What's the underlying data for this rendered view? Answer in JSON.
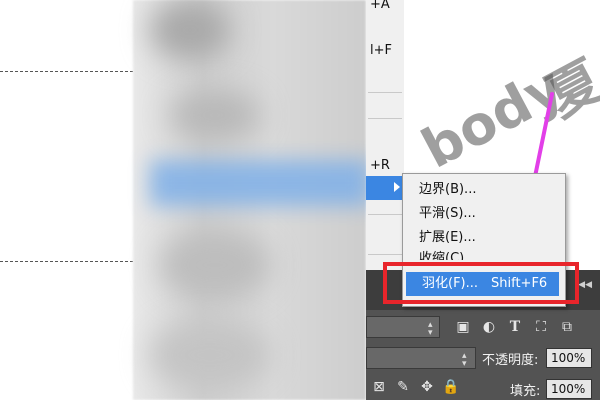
{
  "menu": {
    "shortcut_a": "+A",
    "shortcut_f": "l+F",
    "shortcut_r": "+R"
  },
  "watermark": {
    "text": "body",
    "char": "夏"
  },
  "submenu": {
    "items": [
      {
        "label": "边界(B)..."
      },
      {
        "label": "平滑(S)..."
      },
      {
        "label": "扩展(E)..."
      },
      {
        "label": "收缩(C)..."
      }
    ],
    "feather": {
      "label": "羽化(F)...",
      "shortcut": "Shift+F6"
    }
  },
  "panel": {
    "opacity_label": "不透明度:",
    "opacity_value": "100%",
    "fill_label": "填充:",
    "fill_value": "100%"
  },
  "colors": {
    "highlight": "#3b86e2",
    "annotation_box": "#e8252b",
    "annotation_arrow": "#e23fe8"
  }
}
